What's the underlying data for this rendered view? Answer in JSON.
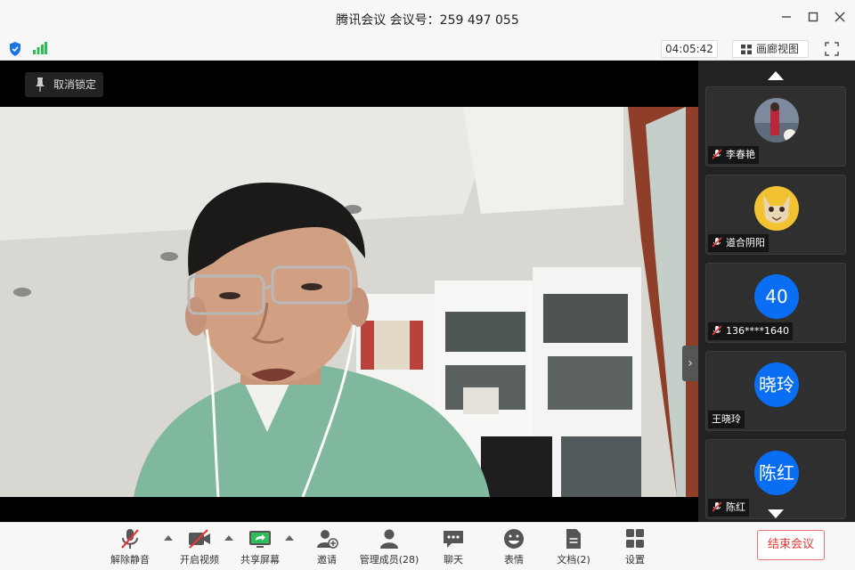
{
  "window": {
    "title": "腾讯会议 会议号：259 497 055",
    "minimize_icon": "minimize-icon",
    "maximize_icon": "maximize-icon",
    "close_icon": "close-icon"
  },
  "status_bar": {
    "timer": "04:05:42",
    "gallery_view_label": "画廊视图",
    "security_icon": "shield-icon",
    "signal_icon": "signal-bars-icon",
    "fullscreen_icon": "fullscreen-icon"
  },
  "main_video": {
    "unpin_label": "取消锁定",
    "collapse_icon": "chevron-right-icon"
  },
  "participants": [
    {
      "name": "李春艳",
      "avatar_type": "photo",
      "avatar_text": "",
      "muted": true
    },
    {
      "name": "道合阴阳",
      "avatar_type": "photo",
      "avatar_text": "",
      "muted": true
    },
    {
      "name": "136****1640",
      "avatar_type": "text",
      "avatar_text": "40",
      "muted": true
    },
    {
      "name": "王晓玲",
      "avatar_type": "text",
      "avatar_text": "晓玲",
      "muted": false
    },
    {
      "name": "陈红",
      "avatar_type": "text",
      "avatar_text": "陈红",
      "muted": true
    }
  ],
  "toolbar": {
    "unmute": "解除静音",
    "start_video": "开启视频",
    "share_screen": "共享屏幕",
    "invite": "邀请",
    "manage_members": "管理成员(28)",
    "chat": "聊天",
    "reactions": "表情",
    "documents": "文档(2)",
    "settings": "设置",
    "end_meeting": "结束会议"
  },
  "colors": {
    "accent_blue": "#0a6ef5",
    "end_red": "#e53935",
    "signal_green": "#2ebd59"
  }
}
